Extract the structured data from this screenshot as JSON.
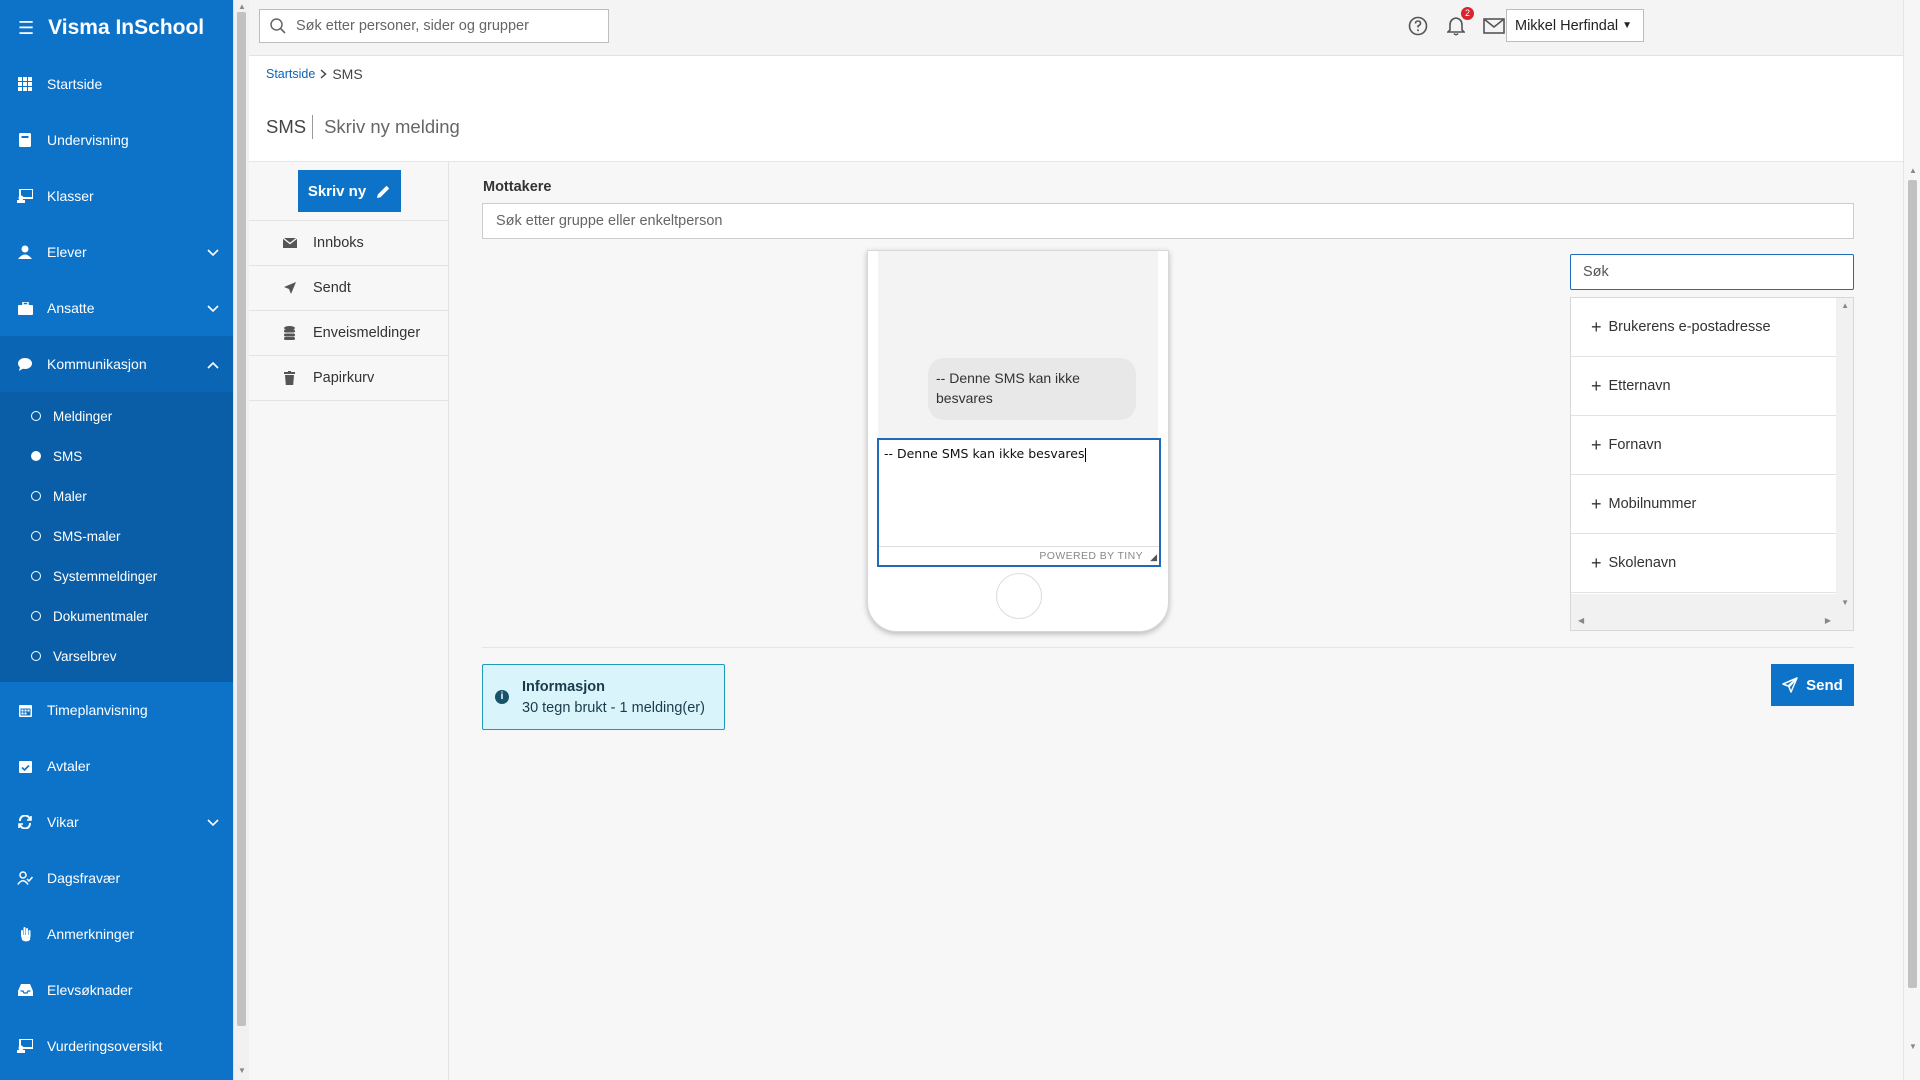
{
  "app": {
    "title": "Visma InSchool"
  },
  "sidebar": {
    "items": [
      {
        "label": "Startside"
      },
      {
        "label": "Undervisning"
      },
      {
        "label": "Klasser"
      },
      {
        "label": "Elever"
      },
      {
        "label": "Ansatte"
      },
      {
        "label": "Kommunikasjon"
      },
      {
        "label": "Timeplanvisning"
      },
      {
        "label": "Avtaler"
      },
      {
        "label": "Vikar"
      },
      {
        "label": "Dagsfravær"
      },
      {
        "label": "Anmerkninger"
      },
      {
        "label": "Elevsøknader"
      },
      {
        "label": "Vurderingsoversikt"
      }
    ],
    "sub_items": [
      {
        "label": "Meldinger"
      },
      {
        "label": "SMS"
      },
      {
        "label": "Maler"
      },
      {
        "label": "SMS-maler"
      },
      {
        "label": "Systemmeldinger"
      },
      {
        "label": "Dokumentmaler"
      },
      {
        "label": "Varselbrev"
      }
    ]
  },
  "topbar": {
    "search_placeholder": "Søk etter personer, sider og grupper",
    "notification_count": "2",
    "user_name": "Mikkel Herfindal"
  },
  "breadcrumb": {
    "home": "Startside",
    "current": "SMS"
  },
  "page": {
    "title": "SMS",
    "subtitle": "Skriv ny melding"
  },
  "mailnav": {
    "write_label": "Skriv ny",
    "items": [
      {
        "label": "Innboks"
      },
      {
        "label": "Sendt"
      },
      {
        "label": "Enveismeldinger"
      },
      {
        "label": "Papirkurv"
      }
    ]
  },
  "form": {
    "recipients_label": "Mottakere",
    "recipients_placeholder": "Søk etter gruppe eller enkeltperson",
    "preview_bubble": "-- Denne SMS kan ikke besvares",
    "editor_text": "-- Denne SMS kan ikke besvares",
    "editor_powered_by": "POWERED BY TINY",
    "merge_search_placeholder": "Søk",
    "merge_fields": [
      {
        "label": "Brukerens e-postadresse"
      },
      {
        "label": "Etternavn"
      },
      {
        "label": "Fornavn"
      },
      {
        "label": "Mobilnummer"
      },
      {
        "label": "Skolenavn"
      }
    ],
    "info_title": "Informasjon",
    "info_text": "30 tegn brukt - 1 melding(er)",
    "send_label": "Send"
  },
  "colors": {
    "brand": "#0c73c9",
    "info_bg": "#d9f4fb",
    "badge": "#d9232d"
  }
}
